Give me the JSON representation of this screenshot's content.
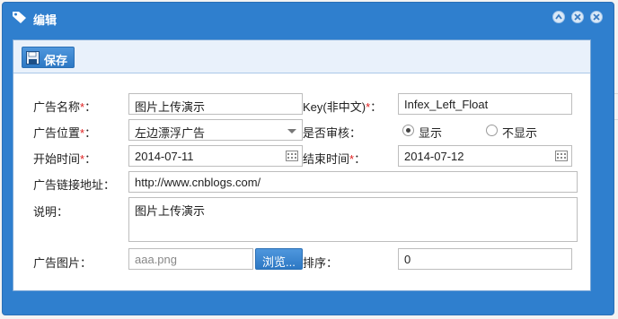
{
  "window": {
    "title": "编辑",
    "buttons": [
      "collapse",
      "minimize",
      "close"
    ]
  },
  "toolbar": {
    "save_label": "保存"
  },
  "form": {
    "ad_name": {
      "label": "广告名称",
      "required_mark": "*",
      "colon": "：",
      "value": "图片上传演示"
    },
    "key": {
      "label": "Key(非中文)",
      "required_mark": "*",
      "colon": "：",
      "value": "Infex_Left_Float"
    },
    "ad_position": {
      "label": "广告位置",
      "required_mark": "*",
      "colon": "：",
      "value": "左边漂浮广告"
    },
    "review": {
      "label": "是否审核：",
      "option_show": "显示",
      "option_hide": "不显示",
      "selected": "显示"
    },
    "start_time": {
      "label": "开始时间",
      "required_mark": "*",
      "colon": "：",
      "value": "2014-07-11"
    },
    "end_time": {
      "label": "结束时间",
      "required_mark": "*",
      "colon": "：",
      "value": "2014-07-12"
    },
    "link": {
      "label": "广告链接地址：",
      "value": "http://www.cnblogs.com/"
    },
    "description": {
      "label": "说明：",
      "value": "图片上传演示"
    },
    "image": {
      "label": "广告图片：",
      "value": "aaa.png",
      "browse_label": "浏览..."
    },
    "sort": {
      "label": "排序：",
      "value": "0"
    }
  },
  "colors": {
    "title_bar": "#2f7fce",
    "accent_button": "#3583cf",
    "required": "#e02020"
  },
  "icons": [
    "tag-icon",
    "collapse-icon",
    "minimize-icon",
    "close-icon",
    "save-disk-icon",
    "calendar-icon",
    "dropdown-arrow-icon"
  ]
}
